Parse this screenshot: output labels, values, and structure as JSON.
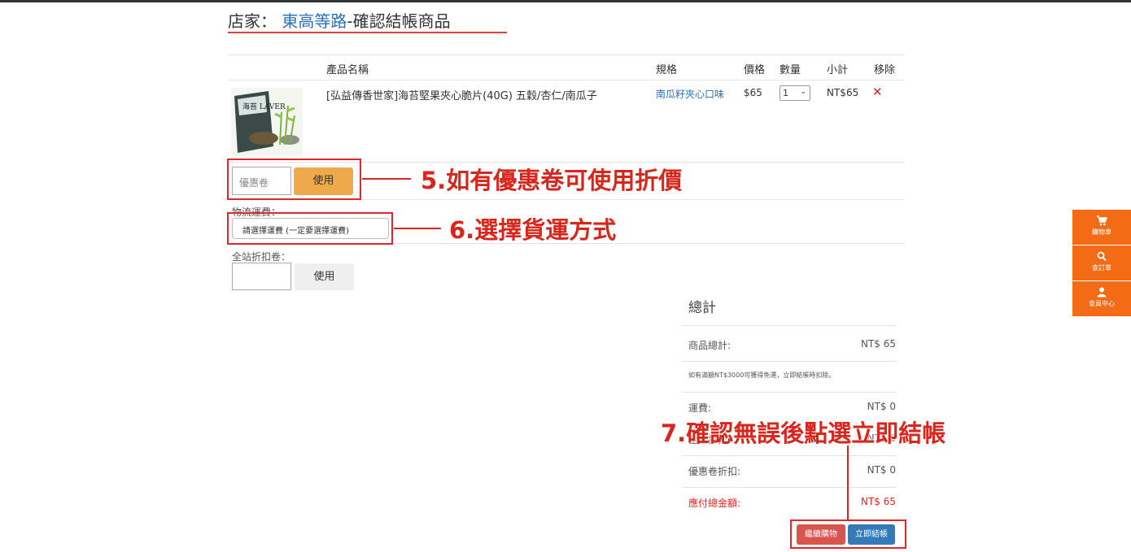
{
  "header": {
    "prefix": "店家：",
    "store": "東高等路",
    "suffix": "-確認結帳商品"
  },
  "table": {
    "headers": [
      "產品名稱",
      "規格",
      "價格",
      "數量",
      "小計",
      "移除"
    ],
    "product": {
      "name": "[弘益傳香世家]海苔堅果夾心脆片(40G) 五穀/杏仁/南瓜子",
      "spec": "南瓜籽夾心口味",
      "price": "$65",
      "qty": "1",
      "subtotal": "NT$65",
      "remove": "✕",
      "image_caption": "海苔 LAVER"
    }
  },
  "coupon": {
    "placeholder": "優惠卷",
    "button": "使用"
  },
  "shipping": {
    "label": "物流運費：",
    "selected": "請選擇運費 (一定要選擇運費)"
  },
  "site_discount": {
    "label": "全站折扣卷：",
    "button": "使用"
  },
  "summary": {
    "title": "總計",
    "goods_label": "商品總計:",
    "goods_value": "NT$ 65",
    "note": "如有滿額NT$3000可獲得免運，立即結帳時扣除。",
    "shipping_label": "運費:",
    "shipping_value": "NT$ 0",
    "site_disc_label": "全站折扣:",
    "site_disc_value": "NT$ 0",
    "coupon_disc_label": "優惠卷折扣:",
    "coupon_disc_value": "NT$ 0",
    "total_label": "應付總金額:",
    "total_value": "NT$ 65",
    "continue_button": "繼續購物",
    "checkout_button": "立即結帳"
  },
  "annotations": {
    "step5": "5.如有優惠卷可使用折價",
    "step6": "6.選擇貨運方式",
    "step7": "7.確認無誤後點選立即結帳"
  },
  "sidebar": {
    "items": [
      {
        "label": "購物車",
        "icon": "cart-icon"
      },
      {
        "label": "查訂單",
        "icon": "search-icon"
      },
      {
        "label": "會員中心",
        "icon": "user-icon"
      }
    ]
  },
  "colors": {
    "accent_red": "#d9261c",
    "brand_blue": "#2a70b5",
    "sidebar_orange": "#f36b14",
    "coupon_button": "#eea94a"
  }
}
